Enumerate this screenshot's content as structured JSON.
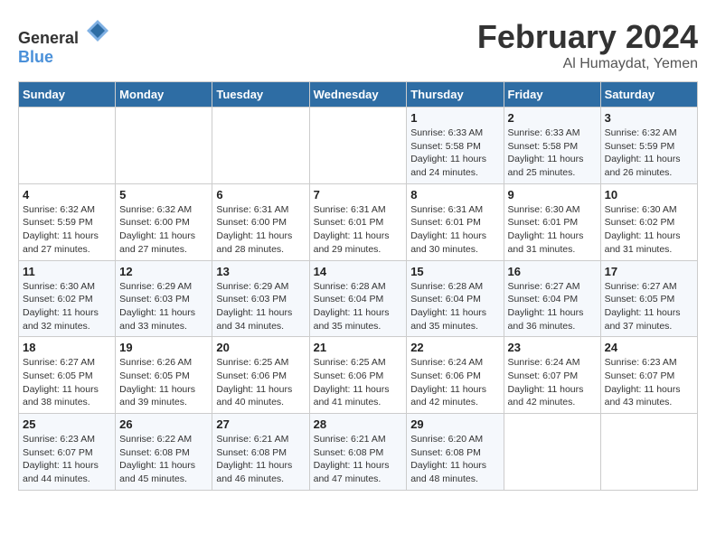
{
  "header": {
    "logo_general": "General",
    "logo_blue": "Blue",
    "month_title": "February 2024",
    "location": "Al Humaydat, Yemen"
  },
  "weekdays": [
    "Sunday",
    "Monday",
    "Tuesday",
    "Wednesday",
    "Thursday",
    "Friday",
    "Saturday"
  ],
  "weeks": [
    [
      {
        "day": "",
        "info": ""
      },
      {
        "day": "",
        "info": ""
      },
      {
        "day": "",
        "info": ""
      },
      {
        "day": "",
        "info": ""
      },
      {
        "day": "1",
        "info": "Sunrise: 6:33 AM\nSunset: 5:58 PM\nDaylight: 11 hours\nand 24 minutes."
      },
      {
        "day": "2",
        "info": "Sunrise: 6:33 AM\nSunset: 5:58 PM\nDaylight: 11 hours\nand 25 minutes."
      },
      {
        "day": "3",
        "info": "Sunrise: 6:32 AM\nSunset: 5:59 PM\nDaylight: 11 hours\nand 26 minutes."
      }
    ],
    [
      {
        "day": "4",
        "info": "Sunrise: 6:32 AM\nSunset: 5:59 PM\nDaylight: 11 hours\nand 27 minutes."
      },
      {
        "day": "5",
        "info": "Sunrise: 6:32 AM\nSunset: 6:00 PM\nDaylight: 11 hours\nand 27 minutes."
      },
      {
        "day": "6",
        "info": "Sunrise: 6:31 AM\nSunset: 6:00 PM\nDaylight: 11 hours\nand 28 minutes."
      },
      {
        "day": "7",
        "info": "Sunrise: 6:31 AM\nSunset: 6:01 PM\nDaylight: 11 hours\nand 29 minutes."
      },
      {
        "day": "8",
        "info": "Sunrise: 6:31 AM\nSunset: 6:01 PM\nDaylight: 11 hours\nand 30 minutes."
      },
      {
        "day": "9",
        "info": "Sunrise: 6:30 AM\nSunset: 6:01 PM\nDaylight: 11 hours\nand 31 minutes."
      },
      {
        "day": "10",
        "info": "Sunrise: 6:30 AM\nSunset: 6:02 PM\nDaylight: 11 hours\nand 31 minutes."
      }
    ],
    [
      {
        "day": "11",
        "info": "Sunrise: 6:30 AM\nSunset: 6:02 PM\nDaylight: 11 hours\nand 32 minutes."
      },
      {
        "day": "12",
        "info": "Sunrise: 6:29 AM\nSunset: 6:03 PM\nDaylight: 11 hours\nand 33 minutes."
      },
      {
        "day": "13",
        "info": "Sunrise: 6:29 AM\nSunset: 6:03 PM\nDaylight: 11 hours\nand 34 minutes."
      },
      {
        "day": "14",
        "info": "Sunrise: 6:28 AM\nSunset: 6:04 PM\nDaylight: 11 hours\nand 35 minutes."
      },
      {
        "day": "15",
        "info": "Sunrise: 6:28 AM\nSunset: 6:04 PM\nDaylight: 11 hours\nand 35 minutes."
      },
      {
        "day": "16",
        "info": "Sunrise: 6:27 AM\nSunset: 6:04 PM\nDaylight: 11 hours\nand 36 minutes."
      },
      {
        "day": "17",
        "info": "Sunrise: 6:27 AM\nSunset: 6:05 PM\nDaylight: 11 hours\nand 37 minutes."
      }
    ],
    [
      {
        "day": "18",
        "info": "Sunrise: 6:27 AM\nSunset: 6:05 PM\nDaylight: 11 hours\nand 38 minutes."
      },
      {
        "day": "19",
        "info": "Sunrise: 6:26 AM\nSunset: 6:05 PM\nDaylight: 11 hours\nand 39 minutes."
      },
      {
        "day": "20",
        "info": "Sunrise: 6:25 AM\nSunset: 6:06 PM\nDaylight: 11 hours\nand 40 minutes."
      },
      {
        "day": "21",
        "info": "Sunrise: 6:25 AM\nSunset: 6:06 PM\nDaylight: 11 hours\nand 41 minutes."
      },
      {
        "day": "22",
        "info": "Sunrise: 6:24 AM\nSunset: 6:06 PM\nDaylight: 11 hours\nand 42 minutes."
      },
      {
        "day": "23",
        "info": "Sunrise: 6:24 AM\nSunset: 6:07 PM\nDaylight: 11 hours\nand 42 minutes."
      },
      {
        "day": "24",
        "info": "Sunrise: 6:23 AM\nSunset: 6:07 PM\nDaylight: 11 hours\nand 43 minutes."
      }
    ],
    [
      {
        "day": "25",
        "info": "Sunrise: 6:23 AM\nSunset: 6:07 PM\nDaylight: 11 hours\nand 44 minutes."
      },
      {
        "day": "26",
        "info": "Sunrise: 6:22 AM\nSunset: 6:08 PM\nDaylight: 11 hours\nand 45 minutes."
      },
      {
        "day": "27",
        "info": "Sunrise: 6:21 AM\nSunset: 6:08 PM\nDaylight: 11 hours\nand 46 minutes."
      },
      {
        "day": "28",
        "info": "Sunrise: 6:21 AM\nSunset: 6:08 PM\nDaylight: 11 hours\nand 47 minutes."
      },
      {
        "day": "29",
        "info": "Sunrise: 6:20 AM\nSunset: 6:08 PM\nDaylight: 11 hours\nand 48 minutes."
      },
      {
        "day": "",
        "info": ""
      },
      {
        "day": "",
        "info": ""
      }
    ]
  ]
}
